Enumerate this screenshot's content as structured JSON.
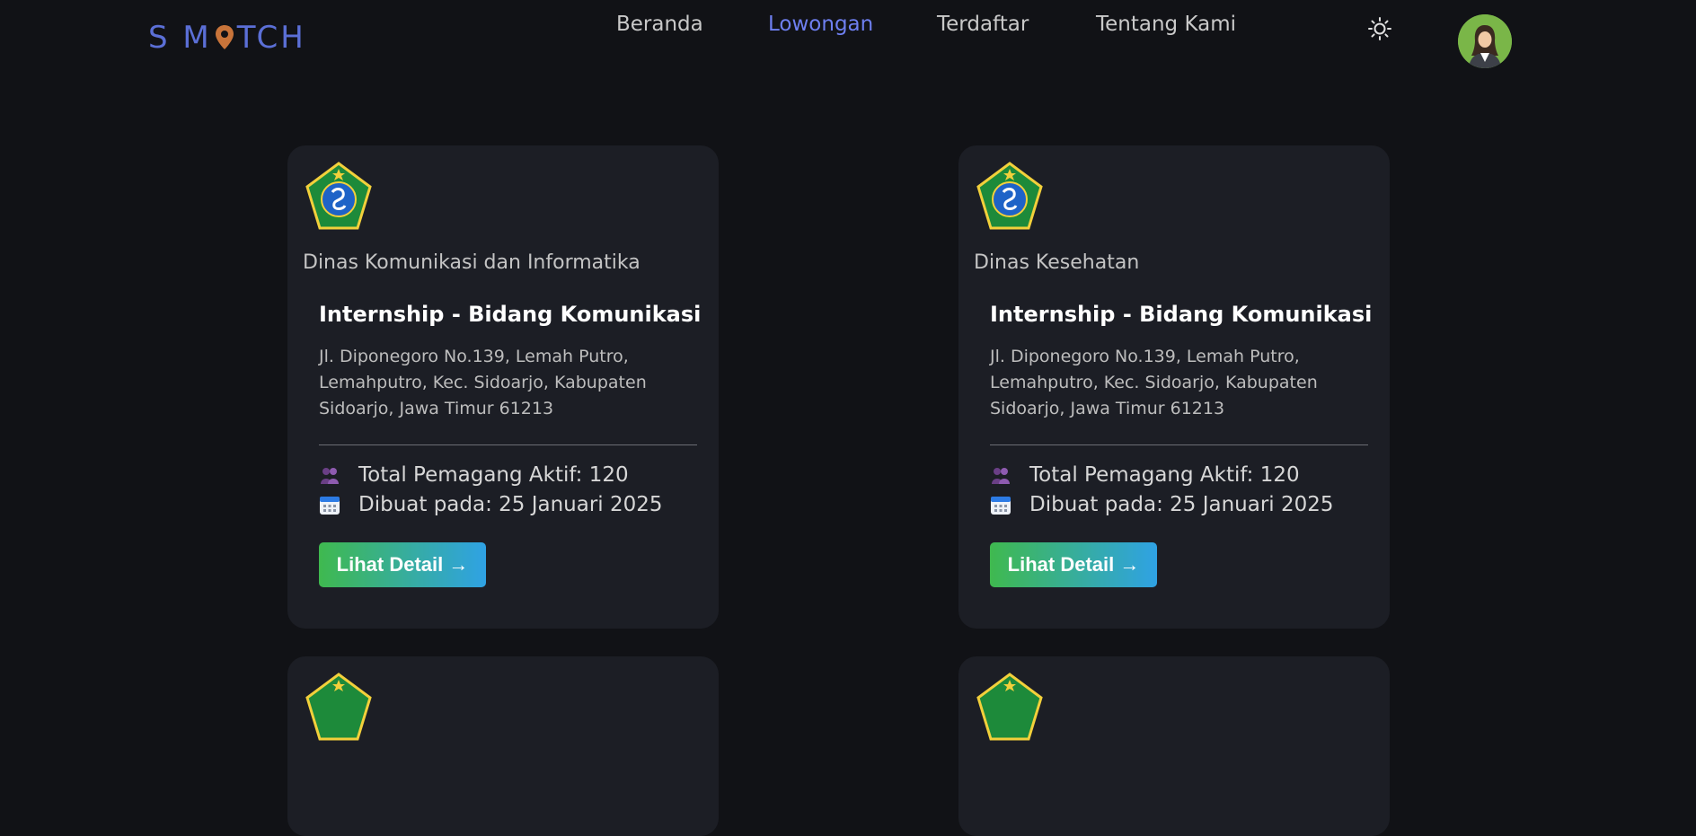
{
  "header": {
    "logo_left": "S M",
    "logo_right": "TCH",
    "nav": [
      {
        "label": "Beranda",
        "active": false
      },
      {
        "label": "Lowongan",
        "active": true
      },
      {
        "label": "Terdaftar",
        "active": false
      },
      {
        "label": "Tentang Kami",
        "active": false
      }
    ],
    "theme_icon": "sun-icon",
    "avatar_icon": "user-avatar"
  },
  "cards": [
    {
      "org": "Dinas Komunikasi dan Informatika",
      "title": "Internship - Bidang Komunikasi",
      "address": "Jl. Diponegoro No.139, Lemah Putro, Lemahputro, Kec. Sidoarjo, Kabupaten Sidoarjo, Jawa Timur 61213",
      "interns": "Total Pemagang Aktif: 120",
      "created": "Dibuat pada: 25 Januari 2025",
      "button": "Lihat Detail →"
    },
    {
      "org": "Dinas Kesehatan",
      "title": "Internship - Bidang Komunikasi",
      "address": "Jl. Diponegoro No.139, Lemah Putro, Lemahputro, Kec. Sidoarjo, Kabupaten Sidoarjo, Jawa Timur 61213",
      "interns": "Total Pemagang Aktif: 120",
      "created": "Dibuat pada: 25 Januari 2025",
      "button": "Lihat Detail →"
    }
  ],
  "colors": {
    "background": "#111216",
    "card": "#1c1e25",
    "accent": "#6e7ff0",
    "logo": "#5b6fd6",
    "button_start": "#3fb94f",
    "button_end": "#2fa2e4"
  }
}
